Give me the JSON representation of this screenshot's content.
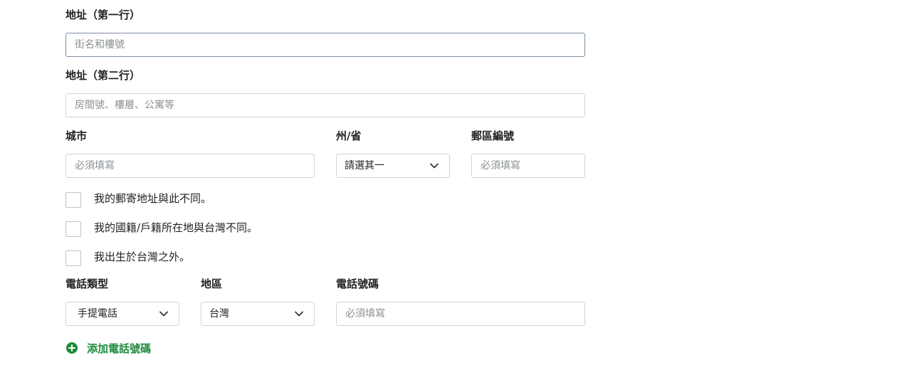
{
  "address1": {
    "label": "地址（第一行）",
    "placeholder": "街名和樓號"
  },
  "address2": {
    "label": "地址（第二行）",
    "placeholder": "房間號、樓層、公寓等"
  },
  "city": {
    "label": "城市",
    "placeholder": "必須填寫"
  },
  "state": {
    "label": "州/省",
    "selected": "請選其一"
  },
  "postal": {
    "label": "郵區編號",
    "placeholder": "必須填寫"
  },
  "checkboxes": [
    {
      "label": "我的郵寄地址與此不同。"
    },
    {
      "label": "我的國籍/戶籍所在地與台灣不同。"
    },
    {
      "label": "我出生於台灣之外。"
    }
  ],
  "phone_type": {
    "label": "電話類型",
    "selected": "手提電話"
  },
  "region": {
    "label": "地區",
    "selected": "台灣"
  },
  "phone_number": {
    "label": "電話號碼",
    "placeholder": "必須填寫"
  },
  "add_phone": {
    "label": "添加電話號碼",
    "icon": "plus-circle-icon",
    "color": "#1e8a3c"
  }
}
